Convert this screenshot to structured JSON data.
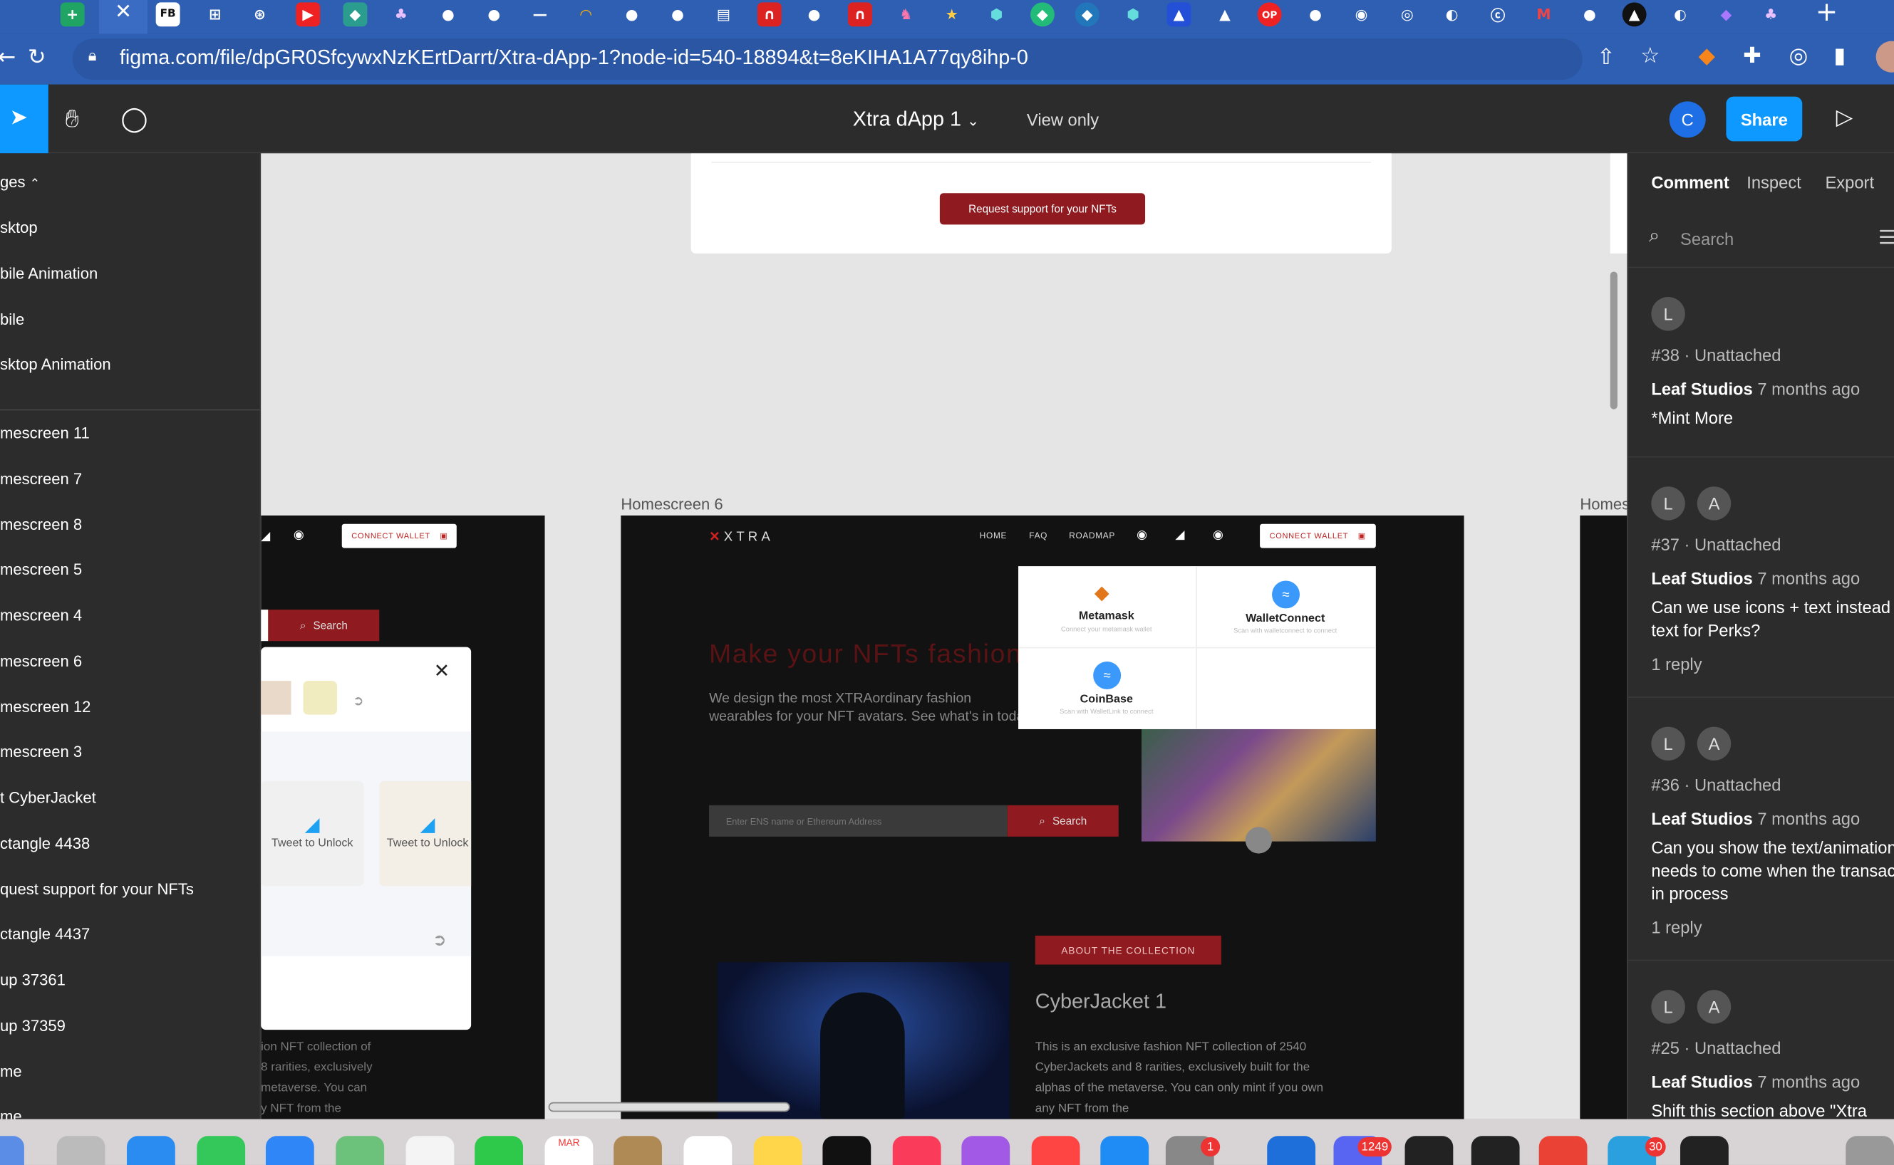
{
  "browser": {
    "url": "figma.com/file/dpGR0SfcywxNzKErtDarrt/Xtra-dApp-1?node-id=540-18894&t=8eKIHA1A77qy8ihp-0",
    "tab_count_hint": "many tabs"
  },
  "figma": {
    "file_title": "Xtra dApp 1",
    "view_mode": "View only",
    "user_initial": "C",
    "share_label": "Share"
  },
  "layers": {
    "pages_header": "ges",
    "pages": [
      "sktop",
      "bile Animation",
      "bile",
      "sktop Animation"
    ],
    "items": [
      "mescreen 11",
      "mescreen 7",
      "mescreen 8",
      "mescreen 5",
      "mescreen 4",
      "mescreen 6",
      "mescreen 12",
      "mescreen 3",
      "t CyberJacket",
      "ctangle 4438",
      "quest support for your NFTs",
      "ctangle 4437",
      "up 37361",
      "up 37359",
      "me",
      "me"
    ]
  },
  "canvas": {
    "request_support_label": "Request support for your NFTs",
    "frame_label_center": "Homescreen 6",
    "frame_label_right": "Homes",
    "left_frame": {
      "connect_wallet": "CONNECT WALLET",
      "search_label": "Search",
      "tweet1": "Tweet to Unlock",
      "tweet2": "Tweet to Unlock",
      "text_lines": [
        "ion NFT collection of",
        "8 rarities, exclusively",
        "metaverse. You can",
        "y NFT from the"
      ]
    },
    "center_frame": {
      "logo": "XTRA",
      "nav": [
        "HOME",
        "FAQ",
        "ROADMAP"
      ],
      "connect_wallet": "CONNECT WALLET",
      "wallets": [
        {
          "name": "Metamask",
          "sub": "Connect your metamask wallet"
        },
        {
          "name": "WalletConnect",
          "sub": "Scan with walletconnect to connect"
        },
        {
          "name": "CoinBase",
          "sub": "Scan with WalletLink to connect"
        }
      ],
      "hero_title": "Make your NFTs fashion",
      "hero_text": "We design the most XTRAordinary fashion wearables for your NFT avatars. See what's in today",
      "ens_placeholder": "Enter ENS name or Ethereum Address",
      "search_label": "Search",
      "about_label": "ABOUT THE COLLECTION",
      "collection_title": "CyberJacket 1",
      "collection_text": "This is an exclusive fashion NFT collection of 2540 CyberJackets and 8 rarities, exclusively built for the alphas of the metaverse. You can only mint if you own any NFT from the"
    }
  },
  "comments_panel": {
    "tabs": [
      "Comment",
      "Inspect",
      "Export"
    ],
    "search_placeholder": "Search",
    "comments": [
      {
        "avatars": [
          "L"
        ],
        "meta": "#38 · Unattached",
        "author": "Leaf Studios",
        "time": "7 months ago",
        "text": "*Mint More",
        "replies": ""
      },
      {
        "avatars": [
          "L",
          "A"
        ],
        "meta": "#37 · Unattached",
        "author": "Leaf Studios",
        "time": "7 months ago",
        "text": "Can we use icons + text instead o text for Perks?",
        "replies": "1 reply"
      },
      {
        "avatars": [
          "L",
          "A"
        ],
        "meta": "#36 · Unattached",
        "author": "Leaf Studios",
        "time": "7 months ago",
        "text": "Can you show the text/animation needs to come when the transac in process",
        "replies": "1 reply"
      },
      {
        "avatars": [
          "L",
          "A"
        ],
        "meta": "#25 · Unattached",
        "author": "Leaf Studios",
        "time": "7 months ago",
        "text": "Shift this section above \"Xtra",
        "replies": ""
      }
    ]
  },
  "dock": {
    "calendar_month": "MAR",
    "badges": [
      "1",
      "1249",
      "30"
    ]
  },
  "colors": {
    "figma_blue": "#0d99ff",
    "brand_red": "#8f1a1f",
    "chrome_blue": "#2f5fb3"
  }
}
